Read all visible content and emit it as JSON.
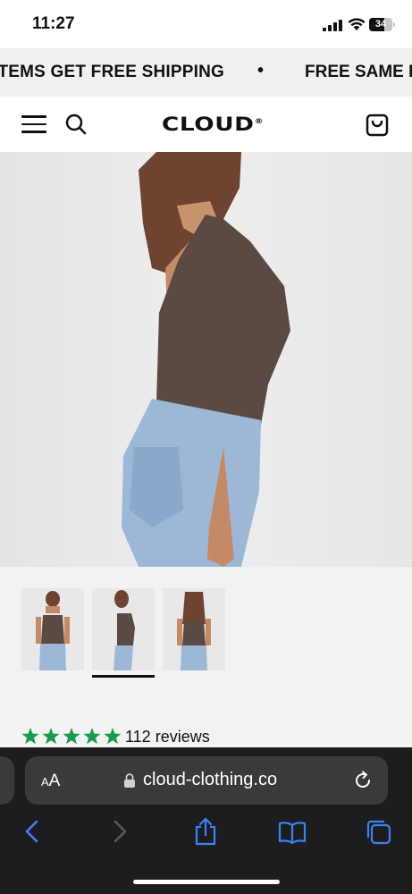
{
  "status_bar": {
    "time": "11:27",
    "battery": "34"
  },
  "announcement": {
    "left_text": "ITEMS GET FREE SHIPPING",
    "separator": "•",
    "right_text": "FREE SAME D"
  },
  "header": {
    "logo": "CLOUD",
    "logo_mark": "®"
  },
  "product": {
    "rating_stars": 5,
    "reviews": "112 reviews",
    "star_color": "#1a9b4b"
  },
  "browser": {
    "aa_small": "A",
    "aa_large": "A",
    "url": "cloud-clothing.co",
    "accent": "#3b82f6"
  }
}
